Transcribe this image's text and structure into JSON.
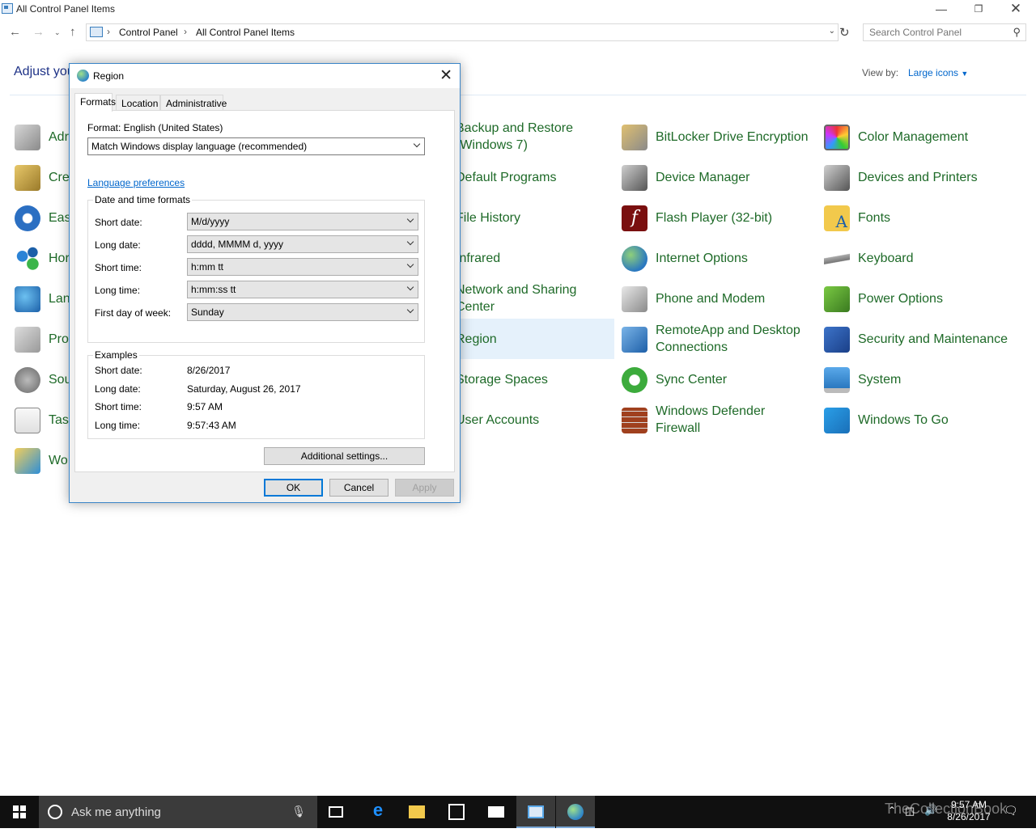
{
  "window": {
    "title": "All Control Panel Items"
  },
  "address": {
    "crumbs": [
      "Control Panel",
      "All Control Panel Items"
    ]
  },
  "search": {
    "placeholder": "Search Control Panel"
  },
  "header": {
    "heading_visible": "Adjust you",
    "view_by_label": "View by:",
    "view_by_value": "Large icons"
  },
  "items": {
    "col1": [
      "Adr",
      "Cre",
      "Eas",
      "Hor",
      "Lan",
      "Pro",
      "Sou",
      "Tasl",
      "Wo"
    ],
    "col2": [
      {
        "label": "Backup and Restore (Windows 7)",
        "line1": "Backup and Restore",
        "line2": "(Windows 7)"
      },
      {
        "label": "Default Programs"
      },
      {
        "label": "File History"
      },
      {
        "label": "Infrared"
      },
      {
        "label": "Network and Sharing Center",
        "line1": "Network and Sharing",
        "line2": "Center"
      },
      {
        "label": "Region"
      },
      {
        "label": "Storage Spaces"
      },
      {
        "label": "User Accounts"
      }
    ],
    "col3": [
      {
        "label": "BitLocker Drive Encryption"
      },
      {
        "label": "Device Manager"
      },
      {
        "label": "Flash Player (32-bit)"
      },
      {
        "label": "Internet Options"
      },
      {
        "label": "Phone and Modem"
      },
      {
        "label": "RemoteApp and Desktop Connections",
        "line1": "RemoteApp and Desktop",
        "line2": "Connections"
      },
      {
        "label": "Sync Center"
      },
      {
        "label": "Windows Defender Firewall",
        "line1": "Windows Defender",
        "line2": "Firewall"
      }
    ],
    "col4": [
      {
        "label": "Color Management"
      },
      {
        "label": "Devices and Printers"
      },
      {
        "label": "Fonts"
      },
      {
        "label": "Keyboard"
      },
      {
        "label": "Power Options"
      },
      {
        "label": "Security and Maintenance"
      },
      {
        "label": "System"
      },
      {
        "label": "Windows To Go"
      }
    ],
    "selected": "Region"
  },
  "dialog": {
    "title": "Region",
    "tabs": [
      "Formats",
      "Location",
      "Administrative"
    ],
    "active_tab": "Formats",
    "format_label": "Format: English (United States)",
    "format_value": "Match Windows display language (recommended)",
    "language_link": "Language preferences",
    "date_time_group": "Date and time formats",
    "fields": [
      {
        "label": "Short date:",
        "value": "M/d/yyyy"
      },
      {
        "label": "Long date:",
        "value": "dddd, MMMM d, yyyy"
      },
      {
        "label": "Short time:",
        "value": "h:mm tt"
      },
      {
        "label": "Long time:",
        "value": "h:mm:ss tt"
      },
      {
        "label": "First day of week:",
        "value": "Sunday"
      }
    ],
    "examples_group": "Examples",
    "examples": [
      {
        "label": "Short date:",
        "value": "8/26/2017"
      },
      {
        "label": "Long date:",
        "value": "Saturday, August 26, 2017"
      },
      {
        "label": "Short time:",
        "value": "9:57 AM"
      },
      {
        "label": "Long time:",
        "value": "9:57:43 AM"
      }
    ],
    "additional_button": "Additional settings...",
    "ok": "OK",
    "cancel": "Cancel",
    "apply": "Apply"
  },
  "taskbar": {
    "search_placeholder": "Ask me anything",
    "time": "9:57 AM",
    "date": "8/26/2017",
    "watermark": "TheCollectionBook"
  },
  "colors": {
    "link": "#0066cc",
    "item_text": "#1e6a28",
    "heading": "#1e3287",
    "selection": "#e5f1fb",
    "dialog_border": "#3a85c8",
    "taskbar": "#101010"
  }
}
